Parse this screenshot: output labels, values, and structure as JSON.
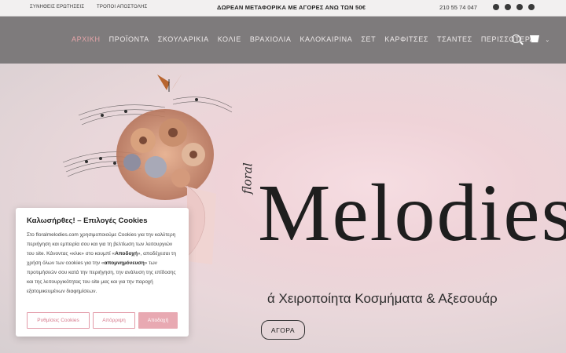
{
  "topbar": {
    "links": [
      "ΣΥΝΗΘΕΙΣ ΕΡΩΤΗΣΕΙΣ",
      "ΤΡΟΠΟΙ ΑΠΟΣΤΟΛΗΣ"
    ],
    "promo": "ΔΩΡΕΑΝ ΜΕΤΑΦΟΡΙΚΑ ΜΕ ΑΓΟΡΕΣ ΑΝΩ ΤΩΝ 50€",
    "phone": "210 55 74 047",
    "social_icons": [
      "facebook-icon",
      "instagram-icon",
      "pinterest-icon",
      "email-icon"
    ]
  },
  "nav": {
    "items": [
      "ΑΡΧΙΚΗ",
      "ΠΡΟΪΟΝΤΑ",
      "ΣΚΟΥΛΑΡΙΚΙΑ",
      "ΚΟΛΙΕ",
      "ΒΡΑΧΙΟΛΙΑ",
      "ΚΑΛΟΚΑΙΡΙΝΑ",
      "ΣΕΤ",
      "ΚΑΡΦΙΤΣΕΣ",
      "ΤΣΑΝΤΕΣ",
      "ΠΕΡΙΣΣΟΤΕΡΑ"
    ],
    "more_chevron": "⌄",
    "active_color": "#e6a5a9"
  },
  "hero": {
    "logo_script": "floral",
    "logo_main": "Melodies",
    "tagline": "ά Χειροποίητα Κοσμήματα & Αξεσουάρ",
    "shop_button": "ΑΓΟΡΑ"
  },
  "cookie": {
    "title": "Καλωσήρθες! – Επιλογές Cookies",
    "body_1": "Στο floralmelodies.com χρησιμοποιούμε Cookies για την καλύτερη περιήγηση και εμπειρία σου και για τη βελτίωση των λειτουργιών του site. Κάνοντας «κλικ» στο κουμπί «",
    "body_bold_1": "Αποδοχή",
    "body_2": "», αποδέχεσαι τη χρήση όλων των cookies για την «",
    "body_bold_2": "απομνημόνευση",
    "body_3": "» των προτιμήσεών σου κατά την περιήγηση, την ανάλυση της επίδοσης και της λειτουργικότητας του site μας και για την παροχή εξατομικευμένων διαφημίσεων.",
    "settings_button": "Ρυθμίσεις Cookies",
    "reject_button": "Απόρριψη",
    "accept_button": "Αποδοχή",
    "accent_color": "#e8a9b2"
  }
}
